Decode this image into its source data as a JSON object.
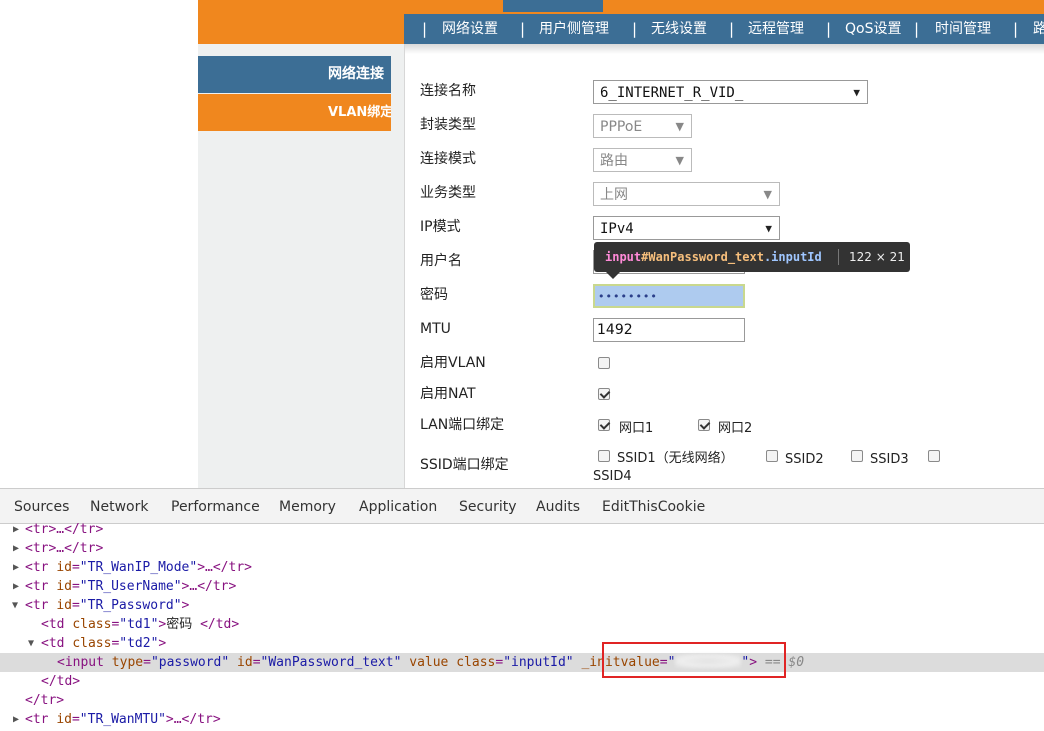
{
  "sidebar": {
    "items": [
      {
        "label": "网络连接"
      },
      {
        "label": "VLAN绑定"
      }
    ]
  },
  "nav": {
    "separator": "|",
    "items": [
      {
        "label": "网络设置"
      },
      {
        "label": "用户侧管理"
      },
      {
        "label": "无线设置"
      },
      {
        "label": "远程管理"
      },
      {
        "label": "QoS设置"
      },
      {
        "label": "时间管理"
      },
      {
        "label": "路"
      }
    ]
  },
  "form": {
    "connection_name": {
      "label": "连接名称",
      "value": "6_INTERNET_R_VID_"
    },
    "encap_type": {
      "label": "封装类型",
      "value": "PPPoE"
    },
    "connection_mode": {
      "label": "连接模式",
      "value": "路由"
    },
    "service_type": {
      "label": "业务类型",
      "value": "上网"
    },
    "ip_mode": {
      "label": "IP模式",
      "value": "IPv4"
    },
    "username": {
      "label": "用户名",
      "value": ""
    },
    "password": {
      "label": "密码",
      "value": "••••••••"
    },
    "mtu": {
      "label": "MTU",
      "value": "1492"
    },
    "enable_vlan": {
      "label": "启用VLAN",
      "checked": false
    },
    "enable_nat": {
      "label": "启用NAT",
      "checked": true
    },
    "lan_binding": {
      "label": "LAN端口绑定",
      "ports": [
        {
          "label": "网口1",
          "checked": true
        },
        {
          "label": "网口2",
          "checked": true
        }
      ]
    },
    "ssid_binding": {
      "label": "SSID端口绑定",
      "ssids": [
        {
          "label": "SSID1（无线网络）",
          "checked": false
        },
        {
          "label": "SSID2",
          "checked": false
        },
        {
          "label": "SSID3",
          "checked": false
        },
        {
          "label": "SSID4",
          "checked": false
        }
      ]
    }
  },
  "tooltip": {
    "tag": "input",
    "id": "#WanPassword_text",
    "cls": ".inputId",
    "size": "122 × 21"
  },
  "devtools": {
    "tabs": [
      "Sources",
      "Network",
      "Performance",
      "Memory",
      "Application",
      "Security",
      "Audits",
      "EditThisCookie"
    ],
    "lines": [
      {
        "text": "<tr>…</tr>"
      },
      {
        "text": "<tr>…</tr>"
      },
      {
        "open": "<tr ",
        "attr": "id",
        "val": "\"TR_WanIP_Mode\"",
        "close": ">…</tr>"
      },
      {
        "open": "<tr ",
        "attr": "id",
        "val": "\"TR_UserName\"",
        "close": ">…</tr>"
      },
      {
        "open": "<tr ",
        "attr": "id",
        "val": "\"TR_Password\"",
        "close": ">"
      },
      {
        "open": "<td ",
        "attr": "class",
        "val": "\"td1\"",
        "mid": ">",
        "text": "密码 ",
        "close": "</td>"
      },
      {
        "open": "<td ",
        "attr": "class",
        "val": "\"td2\"",
        "close": ">"
      },
      {
        "open": "<input ",
        "a1": "type",
        "v1": "\"password\"",
        "a2": "id",
        "v2": "\"WanPassword_text\"",
        "a3": "value",
        "a4": "class",
        "v4": "\"inputId\"",
        "a5": "_initvalue",
        "v5a": "\"",
        "v5b": "\"",
        "close": ">",
        "suffix": "== $0"
      },
      {
        "text": "</td>"
      },
      {
        "text": "</tr>"
      },
      {
        "open": "<tr ",
        "attr": "id",
        "val": "\"TR_WanMTU\"",
        "close": ">…</tr>"
      }
    ]
  }
}
